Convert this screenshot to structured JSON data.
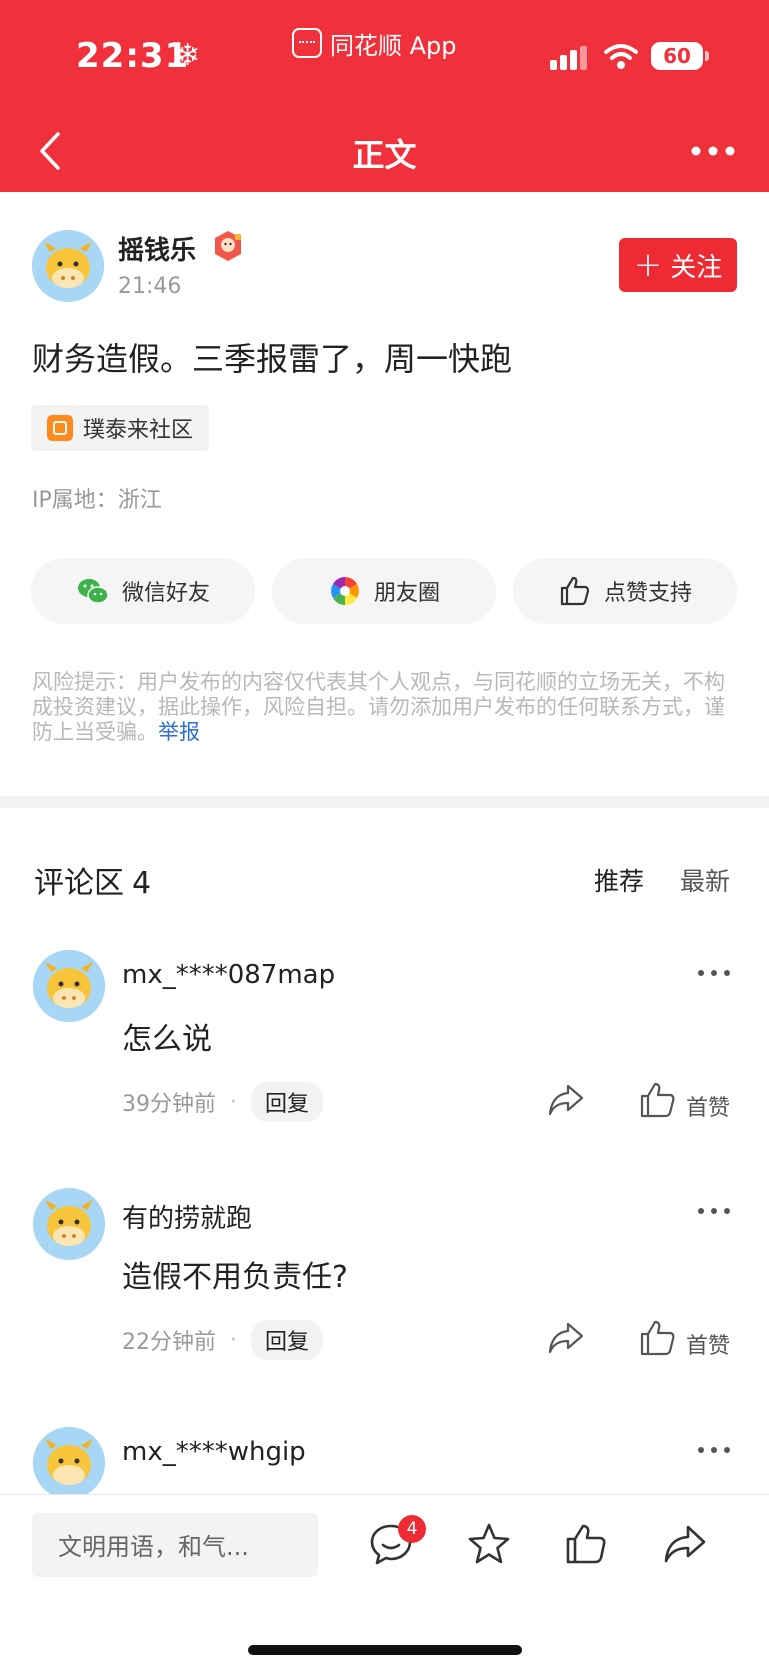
{
  "status_bar": {
    "time": "22:31",
    "snow_glyph": "❄",
    "app_name": "同花顺 App",
    "battery": "60"
  },
  "nav": {
    "title": "正文"
  },
  "post": {
    "author": "摇钱乐",
    "time": "21:46",
    "follow_label": "关注",
    "follow_plus": "+",
    "text": "财务造假。三季报雷了，周一快跑",
    "tag": "璞泰来社区",
    "ip": "IP属地：浙江",
    "share_buttons": [
      {
        "label": "微信好友",
        "icon": "wechat-icon"
      },
      {
        "label": "朋友圈",
        "icon": "moments-icon"
      },
      {
        "label": "点赞支持",
        "icon": "thumbs-up-icon"
      }
    ],
    "risk_notice": "风险提示：用户发布的内容仅代表其个人观点，与同花顺的立场无关，不构成投资建议，据此操作，风险自担。请勿添加用户发布的任何联系方式，谨防上当受骗。",
    "report_label": "举报"
  },
  "comments_section": {
    "title": "评论区",
    "count": "4",
    "sort_recommend": "推荐",
    "sort_latest": "最新",
    "comments": [
      {
        "user": "mx_****087map",
        "text": "怎么说",
        "time": "39分钟前",
        "dot": "·",
        "reply": "回复",
        "like": "首赞"
      },
      {
        "user": "有的捞就跑",
        "text": "造假不用负责任?",
        "time": "22分钟前",
        "dot": "·",
        "reply": "回复",
        "like": "首赞"
      },
      {
        "user": "mx_****whgip",
        "text": "",
        "time": "",
        "dot": "",
        "reply": "",
        "like": ""
      }
    ]
  },
  "bottom_bar": {
    "input_placeholder": "文明用语，和气...",
    "comment_badge": "4"
  },
  "colors": {
    "brand_red": "#f0303a",
    "follow_red": "#ee2a33",
    "link_blue": "#2f6fd6"
  }
}
